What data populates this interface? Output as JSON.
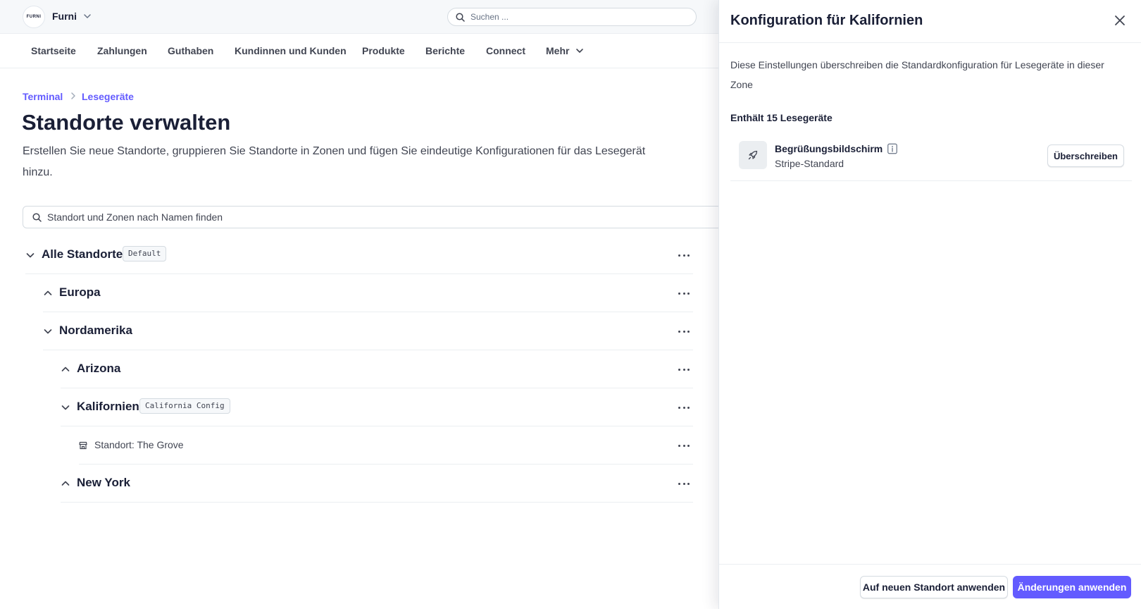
{
  "topbar": {
    "logo_text": "FURNI",
    "account_name": "Furni",
    "search_placeholder": "Suchen ..."
  },
  "nav": {
    "items": [
      {
        "label": "Startseite"
      },
      {
        "label": "Zahlungen"
      },
      {
        "label": "Guthaben"
      },
      {
        "label": "Kundinnen und Kunden"
      },
      {
        "label": "Produkte"
      },
      {
        "label": "Berichte"
      },
      {
        "label": "Connect"
      },
      {
        "label": "Mehr"
      }
    ]
  },
  "breadcrumb": [
    "Terminal",
    "Lesegeräte"
  ],
  "page": {
    "title": "Standorte verwalten",
    "description": "Erstellen Sie neue Standorte, gruppieren Sie Standorte in Zonen und fügen Sie eindeutige Konfigurationen für das Lesegerät hinzu.",
    "search_placeholder": "Standort und Zonen nach Namen finden"
  },
  "tree": [
    {
      "label": "Alle Standorte",
      "badge": "Default",
      "expanded": true,
      "level": 0
    },
    {
      "label": "Europa",
      "badge": "",
      "expanded": false,
      "level": 1
    },
    {
      "label": "Nordamerika",
      "badge": "",
      "expanded": true,
      "level": 1
    },
    {
      "label": "Arizona",
      "badge": "",
      "expanded": false,
      "level": 2
    },
    {
      "label": "Kalifornien",
      "badge": "California Config",
      "expanded": true,
      "level": 2
    },
    {
      "label": "Standort: The Grove",
      "badge": "",
      "type": "store",
      "level": 3
    },
    {
      "label": "New York",
      "badge": "",
      "expanded": false,
      "level": 2
    }
  ],
  "panel": {
    "title": "Konfiguration für Kalifornien",
    "description": "Diese Einstellungen überschreiben die Standardkonfiguration für Lesegeräte in dieser Zone",
    "contains_label": "Enthält 15 Lesegeräte",
    "setting": {
      "name": "Begrüßungsbildschirm",
      "value": "Stripe-Standard",
      "icon": "rocket-icon",
      "override_label": "Überschreiben"
    },
    "footer": {
      "secondary_label": "Auf neuen Standort anwenden",
      "primary_label": "Änderungen anwenden"
    }
  },
  "colors": {
    "accent": "#635bff",
    "text": "#1a1f36",
    "muted": "#414552"
  }
}
